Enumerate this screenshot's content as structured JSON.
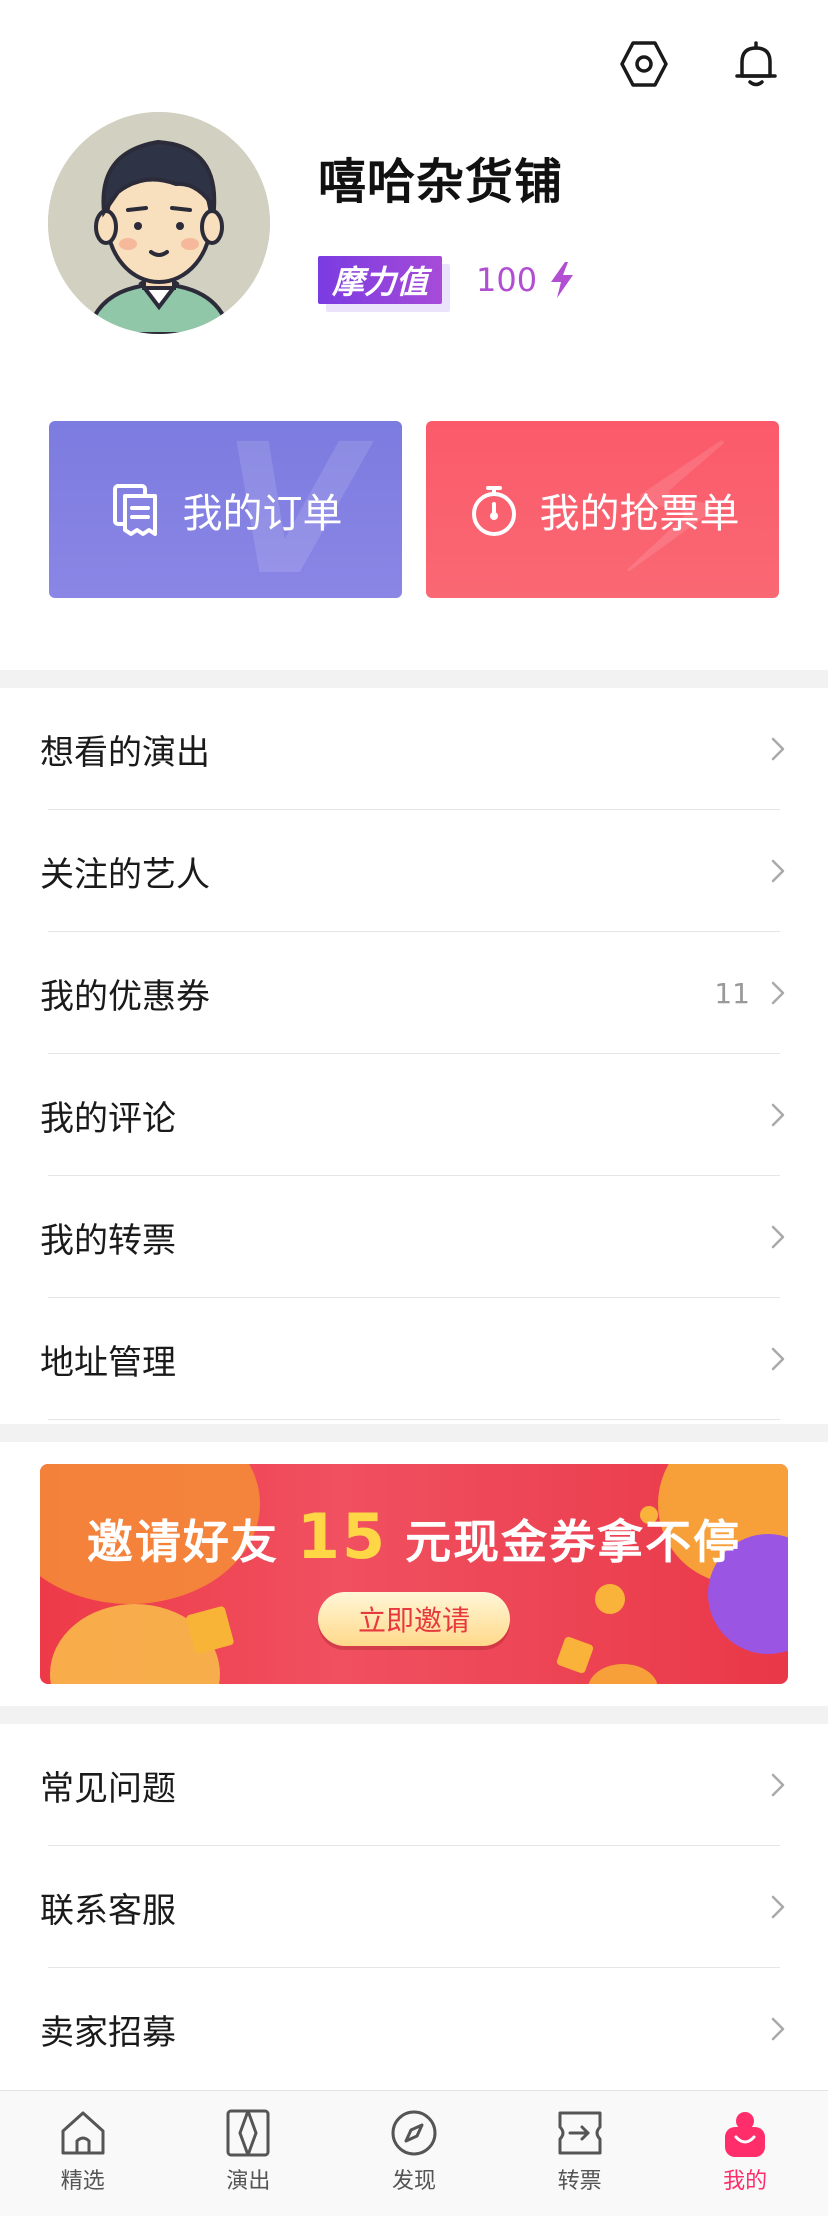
{
  "header": {
    "settings_icon": "hexagon-settings-icon",
    "notify_icon": "bell-icon"
  },
  "profile": {
    "username": "嘻哈杂货铺",
    "badge_label": "摩力值",
    "moli_value": "100"
  },
  "cards": {
    "orders_label": "我的订单",
    "grab_label": "我的抢票单"
  },
  "menu_primary": [
    {
      "label": "想看的演出",
      "count": ""
    },
    {
      "label": "关注的艺人",
      "count": ""
    },
    {
      "label": "我的优惠券",
      "count": "11"
    },
    {
      "label": "我的评论",
      "count": ""
    },
    {
      "label": "我的转票",
      "count": ""
    },
    {
      "label": "地址管理",
      "count": ""
    }
  ],
  "banner": {
    "title_prefix": "邀请好友",
    "title_amount": "15",
    "title_suffix": "元现金券拿不停",
    "button_label": "立即邀请"
  },
  "menu_secondary": [
    {
      "label": "常见问题"
    },
    {
      "label": "联系客服"
    },
    {
      "label": "卖家招募"
    }
  ],
  "tabbar": {
    "tabs": [
      {
        "label": "精选"
      },
      {
        "label": "演出"
      },
      {
        "label": "发现"
      },
      {
        "label": "转票"
      },
      {
        "label": "我的"
      }
    ],
    "active_index": 4
  },
  "colors": {
    "accent_pink": "#ff2d6a",
    "orders_card": "#7c7bdf",
    "grab_card": "#fb5a6a",
    "moli_purple": "#b14ed2"
  }
}
